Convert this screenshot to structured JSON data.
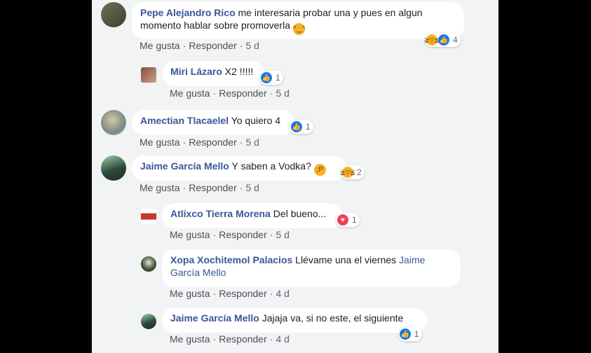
{
  "actions": {
    "like": "Me gusta",
    "reply": "Responder",
    "sep": "·"
  },
  "comments": [
    {
      "author": "Pepe Alejandro Rico",
      "text": "me interesaria probar una y pues en algun momento hablar sobre promoverla",
      "emoji": "😄",
      "time": "5 d",
      "reaction_count": "4"
    },
    {
      "author": "Miri Lázaro",
      "text": "X2 !!!!!",
      "time": "5 d",
      "reaction_count": "1"
    },
    {
      "author": "Amectian Tlacaelel",
      "text": "Yo quiero 4",
      "time": "5 d",
      "reaction_count": "1"
    },
    {
      "author": "Jaime García Mello",
      "text": "Y saben a Vodka?",
      "emoji": "😜",
      "time": "5 d",
      "reaction_count": "2"
    },
    {
      "author": "Atlixco Tierra Morena",
      "text": "Del bueno...",
      "time": "5 d",
      "reaction_count": "1"
    },
    {
      "author": "Xopa Xochitemol Palacios",
      "text": "Llévame una el viernes",
      "mention": "Jaime García Mello",
      "time": "4 d",
      "reaction_count": ""
    },
    {
      "author": "Jaime García Mello",
      "text": "Jajaja va, si no este, el siguiente",
      "time": "4 d",
      "reaction_count": "1"
    }
  ]
}
